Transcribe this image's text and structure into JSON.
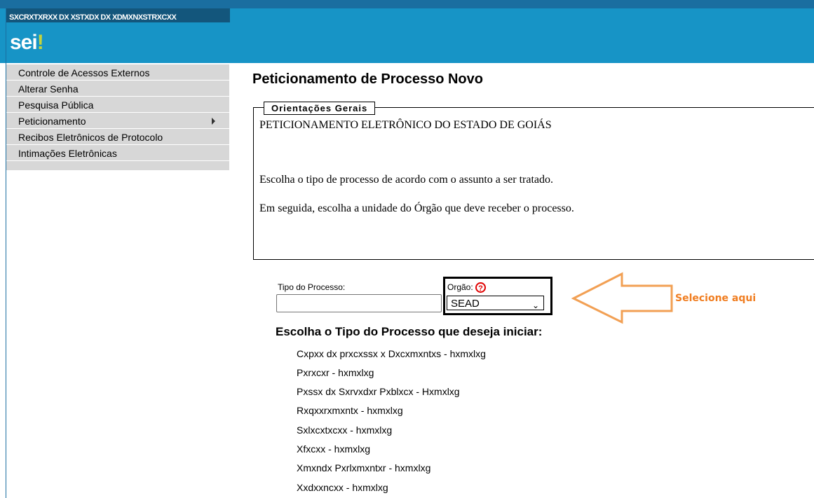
{
  "header": {
    "org_title": "SXCRXTXRXX DX XSTXDX DX XDMXNXSTRXCXX",
    "logo_text": "sei",
    "logo_mark": "!",
    "bar_color": "#1794c6"
  },
  "sidebar": {
    "items": [
      {
        "label": "Controle de Acessos Externos"
      },
      {
        "label": "Alterar Senha"
      },
      {
        "label": "Pesquisa Pública"
      },
      {
        "label": "Peticionamento"
      },
      {
        "label": "Recibos Eletrônicos de Protocolo"
      },
      {
        "label": "Intimações Eletrônicas"
      }
    ]
  },
  "main": {
    "title": "Peticionamento de Processo Novo",
    "orientacoes": {
      "legend": "Orientações Gerais",
      "lines": [
        "PETICIONAMENTO ELETRÔNICO DO ESTADO DE GOIÁS",
        "Escolha o tipo de processo de acordo com o assunto a ser tratado.",
        "Em seguida, escolha a unidade do Órgão que deve receber o processo."
      ]
    },
    "tipo_label": "Tipo do Processo:",
    "tipo_value": "",
    "orgao_label": "Orgão:",
    "orgao_help": "?",
    "orgao_selected": "SEAD",
    "annotation": "Selecione aqui",
    "choose_heading": "Escolha o Tipo do Processo que deseja iniciar:",
    "process_types": [
      "Cxpxx dx prxcxssx x Dxcxmxntxs - hxmxlxg",
      "Pxrxcxr - hxmxlxg",
      "Pxssx dx Sxrvxdxr Pxblxcx - Hxmxlxg",
      "Rxqxxrxmxntx - hxmxlxg",
      "Sxlxcxtxcxx - hxmxlxg",
      "Xfxcxx - hxmxlxg",
      "Xmxndx Pxrlxmxntxr - hxmxlxg",
      "Xxdxxncxx - hxmxlxg"
    ]
  }
}
